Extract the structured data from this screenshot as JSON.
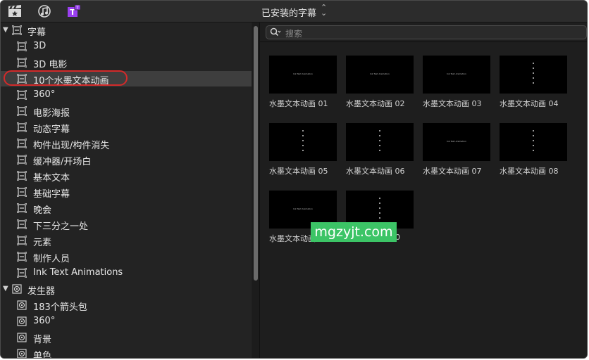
{
  "header": {
    "title": "已安装的字幕",
    "title_chevron": "⌃⌄"
  },
  "toolbar_icons": [
    "clapper-icon",
    "music-icon",
    "titles-icon"
  ],
  "accent_color": "#9a3ff0",
  "sidebar": {
    "groups": [
      {
        "label": "字幕",
        "icon": "title-frame-icon"
      },
      {
        "label": "发生器",
        "icon": "generator-icon"
      }
    ],
    "title_items": [
      {
        "label": "3D"
      },
      {
        "label": "3D 电影"
      },
      {
        "label": "10个水墨文本动画"
      },
      {
        "label": "360°"
      },
      {
        "label": "电影海报"
      },
      {
        "label": "动态字幕"
      },
      {
        "label": "构件出现/构件消失"
      },
      {
        "label": "缓冲器/开场白"
      },
      {
        "label": "基本文本"
      },
      {
        "label": "基础字幕"
      },
      {
        "label": "晚会"
      },
      {
        "label": "下三分之一处"
      },
      {
        "label": "元素"
      },
      {
        "label": "制作人员"
      },
      {
        "label": "Ink Text Animations"
      }
    ],
    "generator_items": [
      {
        "label": "183个箭头包"
      },
      {
        "label": "360°"
      },
      {
        "label": "背景"
      },
      {
        "label": "单色"
      }
    ],
    "selected_item": "10个水墨文本动画"
  },
  "search": {
    "placeholder": "搜索"
  },
  "grid": {
    "items": [
      {
        "caption": "水墨文本动画 01",
        "preview_text": "Ink Text Animation",
        "style": "horizontal"
      },
      {
        "caption": "水墨文本动画 02",
        "preview_text": "Ink Text Animation",
        "style": "horizontal"
      },
      {
        "caption": "水墨文本动画 03",
        "preview_text": "Ink Text Animation",
        "style": "horizontal"
      },
      {
        "caption": "水墨文本动画 04",
        "preview_text": "",
        "style": "vertical"
      },
      {
        "caption": "水墨文本动画 05",
        "preview_text": "",
        "style": "vertical"
      },
      {
        "caption": "水墨文本动画 06",
        "preview_text": "",
        "style": "vertical"
      },
      {
        "caption": "水墨文本动画 07",
        "preview_text": "Ink Text Animation",
        "style": "horizontal"
      },
      {
        "caption": "水墨文本动画 08",
        "preview_text": "",
        "style": "vertical"
      },
      {
        "caption": "水墨文本动画",
        "preview_text": "Ink Text Animation",
        "style": "horizontal"
      },
      {
        "caption": "0",
        "preview_text": "",
        "style": "vertical"
      }
    ]
  },
  "watermark": {
    "text": "mgzyjt.com",
    "color": "#3cc466"
  }
}
